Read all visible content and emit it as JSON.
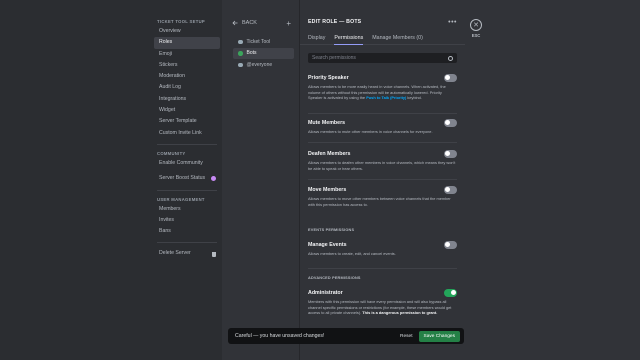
{
  "nav": {
    "header": "TICKET TOOL SETUP",
    "items": [
      "Overview",
      "Roles",
      "Emoji",
      "Stickers",
      "Moderation",
      "Audit Log",
      "Integrations",
      "Widget",
      "Server Template",
      "Custom Invite Link"
    ],
    "community_header": "COMMUNITY",
    "community_items": [
      "Enable Community"
    ],
    "boost_label": "Server Boost Status",
    "user_mgmt_header": "USER MANAGEMENT",
    "user_mgmt_items": [
      "Members",
      "Invites",
      "Bans"
    ],
    "delete_label": "Delete Server"
  },
  "roles": {
    "back_label": "BACK",
    "plus": "+",
    "items": [
      {
        "name": "Ticket Tool",
        "color": "#99aab5"
      },
      {
        "name": "Bots",
        "color": "#3ba55c"
      },
      {
        "name": "@everyone",
        "color": "#99aab5"
      }
    ]
  },
  "main": {
    "title": "EDIT ROLE — BOTS",
    "more": "•••",
    "tabs": [
      "Display",
      "Permissions",
      "Manage Members (0)"
    ],
    "search_placeholder": "Search permissions",
    "perms": [
      {
        "name": "Priority Speaker",
        "desc_pre": "Allows members to be more easily heard in voice channels. When activated, the volume of others without this permission will be automatically lowered. Priority Speaker is activated by using the ",
        "link": "Push to Talk (Priority)",
        "desc_post": " keybind.",
        "enabled": false
      },
      {
        "name": "Mute Members",
        "desc": "Allows members to mute other members in voice channels for everyone.",
        "enabled": false
      },
      {
        "name": "Deafen Members",
        "desc": "Allows members to deafen other members in voice channels, which means they won't be able to speak or hear others.",
        "enabled": false
      },
      {
        "name": "Move Members",
        "desc": "Allows members to move other members between voice channels that the member with this permission has access to.",
        "enabled": false
      },
      {
        "name": "Manage Events",
        "desc": "Allows members to create, edit, and cancel events.",
        "enabled": false
      },
      {
        "name": "Administrator",
        "desc": "Members with this permission will have every permission and will also bypass all channel specific permissions or restrictions (for example, these members would get access to all private channels). ",
        "desc_bold": "This is a dangerous permission to grant.",
        "enabled": true
      }
    ],
    "events_header": "EVENTS PERMISSIONS",
    "advanced_header": "ADVANCED PERMISSIONS"
  },
  "close": {
    "icon": "✕",
    "esc": "ESC"
  },
  "unsaved": {
    "text": "Careful — you have unsaved changes!",
    "reset": "Reset",
    "save": "Save Changes"
  },
  "colors": {
    "accent": "#5865f2",
    "save_green": "#248046",
    "toggle_on": "#23a55a",
    "boost": "#c78af4"
  }
}
